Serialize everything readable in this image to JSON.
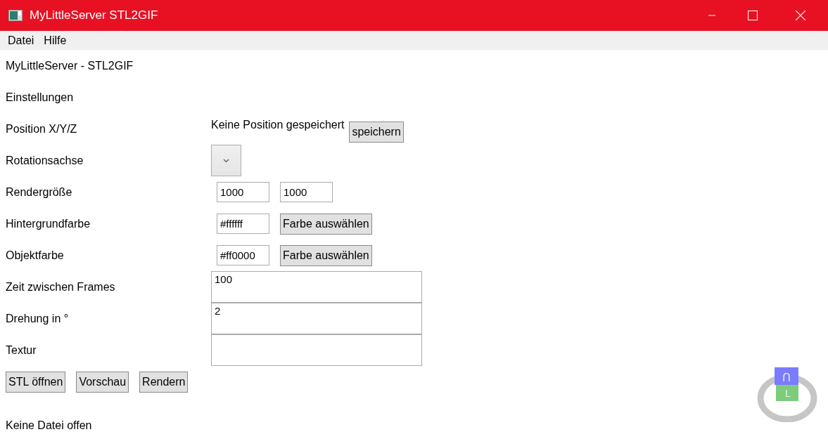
{
  "window": {
    "title": "MyLittleServer STL2GIF"
  },
  "menu": [
    "Datei",
    "Hilfe"
  ],
  "heading": "MyLittleServer - STL2GIF",
  "section": "Einstellungen",
  "rows": [
    {
      "kind": "text_button",
      "label": "Position X/Y/Z",
      "text": "Keine Position gespeichert",
      "button": "speichern"
    },
    {
      "kind": "dropdown",
      "label": "Rotationsachse"
    },
    {
      "kind": "two_inputs",
      "label": "Rendergröße",
      "values": [
        "1000",
        "1000"
      ]
    },
    {
      "kind": "input_button",
      "label": "Hintergrundfarbe",
      "value": "#ffffff",
      "button": "Farbe auswählen"
    },
    {
      "kind": "input_button",
      "label": "Objektfarbe",
      "value": "#ff0000",
      "button": "Farbe auswählen"
    },
    {
      "kind": "textarea",
      "label": "Zeit zwischen Frames",
      "value": "100"
    },
    {
      "kind": "textarea",
      "label": "Drehung in °",
      "value": "2"
    },
    {
      "kind": "textarea",
      "label": "Textur",
      "value": ""
    }
  ],
  "actions": [
    "STL öffnen",
    "Vorschau",
    "Rendern"
  ],
  "status": "Keine Datei offen",
  "viewcube": {
    "top": "U",
    "front": "L"
  }
}
